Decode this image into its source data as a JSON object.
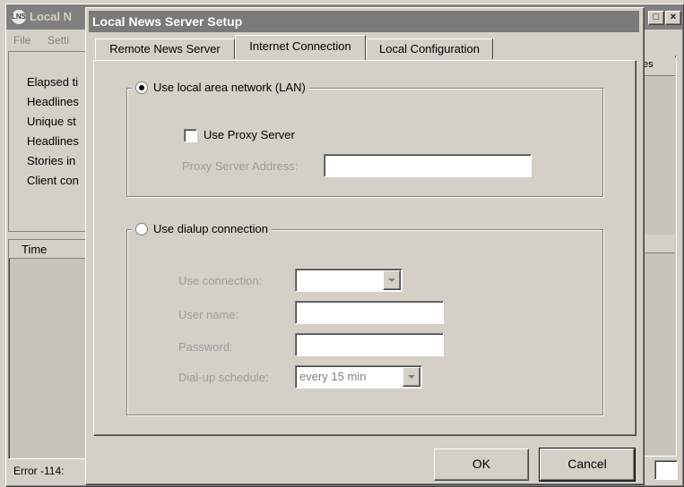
{
  "background_window": {
    "title": "Local N",
    "logo": "LNS",
    "menu": [
      "File",
      "Setti"
    ],
    "stats": [
      "Elapsed ti",
      "Headlines",
      "Unique st",
      "Headlines",
      "Stories in",
      "Client con"
    ],
    "list_header": "Time",
    "right_header": "tes",
    "status": "Error -114:",
    "max_glyph": "□",
    "close_glyph": "×"
  },
  "dialog": {
    "title": "Local News Server Setup",
    "tabs": [
      {
        "label": "Remote News Server",
        "active": false
      },
      {
        "label": "Internet Connection",
        "active": true
      },
      {
        "label": "Local Configuration",
        "active": false
      }
    ],
    "lan": {
      "label": "Use local area network (LAN)",
      "selected": true,
      "proxy_checkbox_label": "Use Proxy Server",
      "proxy_checked": false,
      "proxy_address_label": "Proxy Server Address:",
      "proxy_address_value": ""
    },
    "dialup": {
      "label": "Use dialup connection",
      "selected": false,
      "connection_label": "Use connection:",
      "connection_value": "",
      "username_label": "User name:",
      "username_value": "",
      "password_label": "Password:",
      "password_value": "",
      "schedule_label": "Dial-up schedule:",
      "schedule_value": "every 15 min"
    },
    "ok_label": "OK",
    "cancel_label": "Cancel"
  }
}
